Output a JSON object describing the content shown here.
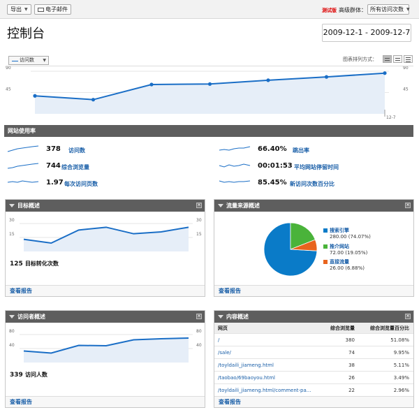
{
  "toolbar": {
    "export_label": "导出",
    "email_label": "电子邮件",
    "beta_label": "测试版",
    "segment_label": "高级群体：",
    "segment_value": "所有访问次数"
  },
  "header": {
    "title": "控制台",
    "date_range": "2009-12-1 - 2009-12-7"
  },
  "main_chart_controls": {
    "metric_select": "访问数",
    "view_mode_label": "图表排列方式："
  },
  "chart_data": [
    {
      "type": "area",
      "id": "visits",
      "y_ticks_left": [
        "90",
        "45"
      ],
      "y_ticks_right": [
        "90",
        "45"
      ],
      "x_label": "12-7",
      "ylim": [
        0,
        90
      ],
      "values": [
        38,
        30,
        62,
        63,
        71,
        78,
        86
      ],
      "color": "#1a6ec6",
      "fill": "#e6eef8"
    },
    {
      "type": "area",
      "id": "goals",
      "y_ticks_left": [
        "30",
        "15"
      ],
      "y_ticks_right": [
        "30",
        "15"
      ],
      "ylim": [
        0,
        30
      ],
      "values": [
        13,
        9,
        23,
        26,
        19,
        21,
        26
      ],
      "color": "#1a6ec6",
      "fill": "#e6eef8"
    },
    {
      "type": "pie",
      "id": "traffic",
      "slices": [
        {
          "name": "搜索引擎",
          "value": 280.0,
          "pct": "74.07%",
          "color": "#0a7bc8",
          "text": "280.00 (74.07%)"
        },
        {
          "name": "推介网站",
          "value": 72.0,
          "pct": "19.05%",
          "color": "#4ab33a",
          "text": "72.00 (19.05%)"
        },
        {
          "name": "直接流量",
          "value": 26.0,
          "pct": "6.88%",
          "color": "#e8641e",
          "text": "26.00 (6.88%)"
        }
      ]
    },
    {
      "type": "area",
      "id": "visitors",
      "y_ticks_left": [
        "80",
        "40"
      ],
      "y_ticks_right": [
        "80",
        "40"
      ],
      "ylim": [
        0,
        80
      ],
      "values": [
        33,
        27,
        49,
        48,
        65,
        68,
        70
      ],
      "color": "#1a6ec6",
      "fill": "#e6eef8"
    }
  ],
  "usage": {
    "title": "网站使用率",
    "items": [
      {
        "value": "378",
        "label": "访问数"
      },
      {
        "value": "744",
        "label": "综合浏览量"
      },
      {
        "value": "1.97",
        "label": "每次访问页数"
      },
      {
        "value": "66.40%",
        "label": "跳出率"
      },
      {
        "value": "00:01:53",
        "label": "平均网站停留时间"
      },
      {
        "value": "85.45%",
        "label": "新访问次数百分比"
      }
    ]
  },
  "goals_panel": {
    "title": "目标概述",
    "summary_value": "125",
    "summary_label": "目标转化次数",
    "report_link": "查看报告"
  },
  "traffic_panel": {
    "title": "流量来源概述",
    "report_link": "查看报告"
  },
  "visitors_panel": {
    "title": "访问者概述",
    "summary_value": "339",
    "summary_label": "访问人数",
    "report_link": "查看报告"
  },
  "content_panel": {
    "title": "内容概述",
    "columns": [
      "网页",
      "综合浏览量",
      "综合浏览量百分比"
    ],
    "rows": [
      [
        "/",
        "380",
        "51.08%"
      ],
      [
        "/sale/",
        "74",
        "9.95%"
      ],
      [
        "/toyldaili_jiameng.html",
        "38",
        "5.11%"
      ],
      [
        "/taobao/69baoyou.html",
        "26",
        "3.49%"
      ],
      [
        "/toyldaili_jiameng.html/comment-pa...",
        "22",
        "2.96%"
      ]
    ],
    "report_link": "查看报告"
  }
}
